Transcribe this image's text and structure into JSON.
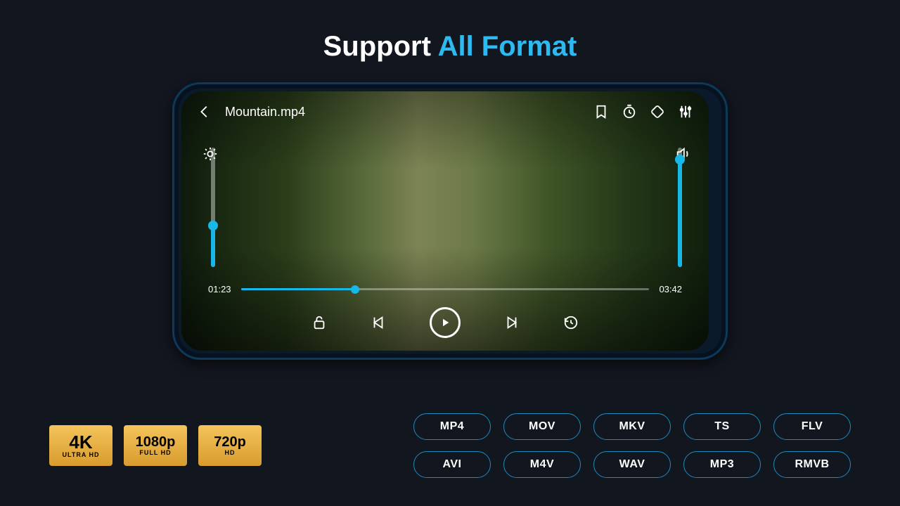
{
  "heading": {
    "part1": "Support",
    "part2": "All Format"
  },
  "player": {
    "filename": "Mountain.mp4",
    "currentTime": "01:23",
    "duration": "03:42"
  },
  "badges": [
    {
      "big": "4K",
      "small": "ULTRA HD"
    },
    {
      "big": "1080p",
      "small": "FULL HD"
    },
    {
      "big": "720p",
      "small": "HD"
    }
  ],
  "formats": [
    "MP4",
    "MOV",
    "MKV",
    "TS",
    "FLV",
    "AVI",
    "M4V",
    "WAV",
    "MP3",
    "RMVB"
  ]
}
